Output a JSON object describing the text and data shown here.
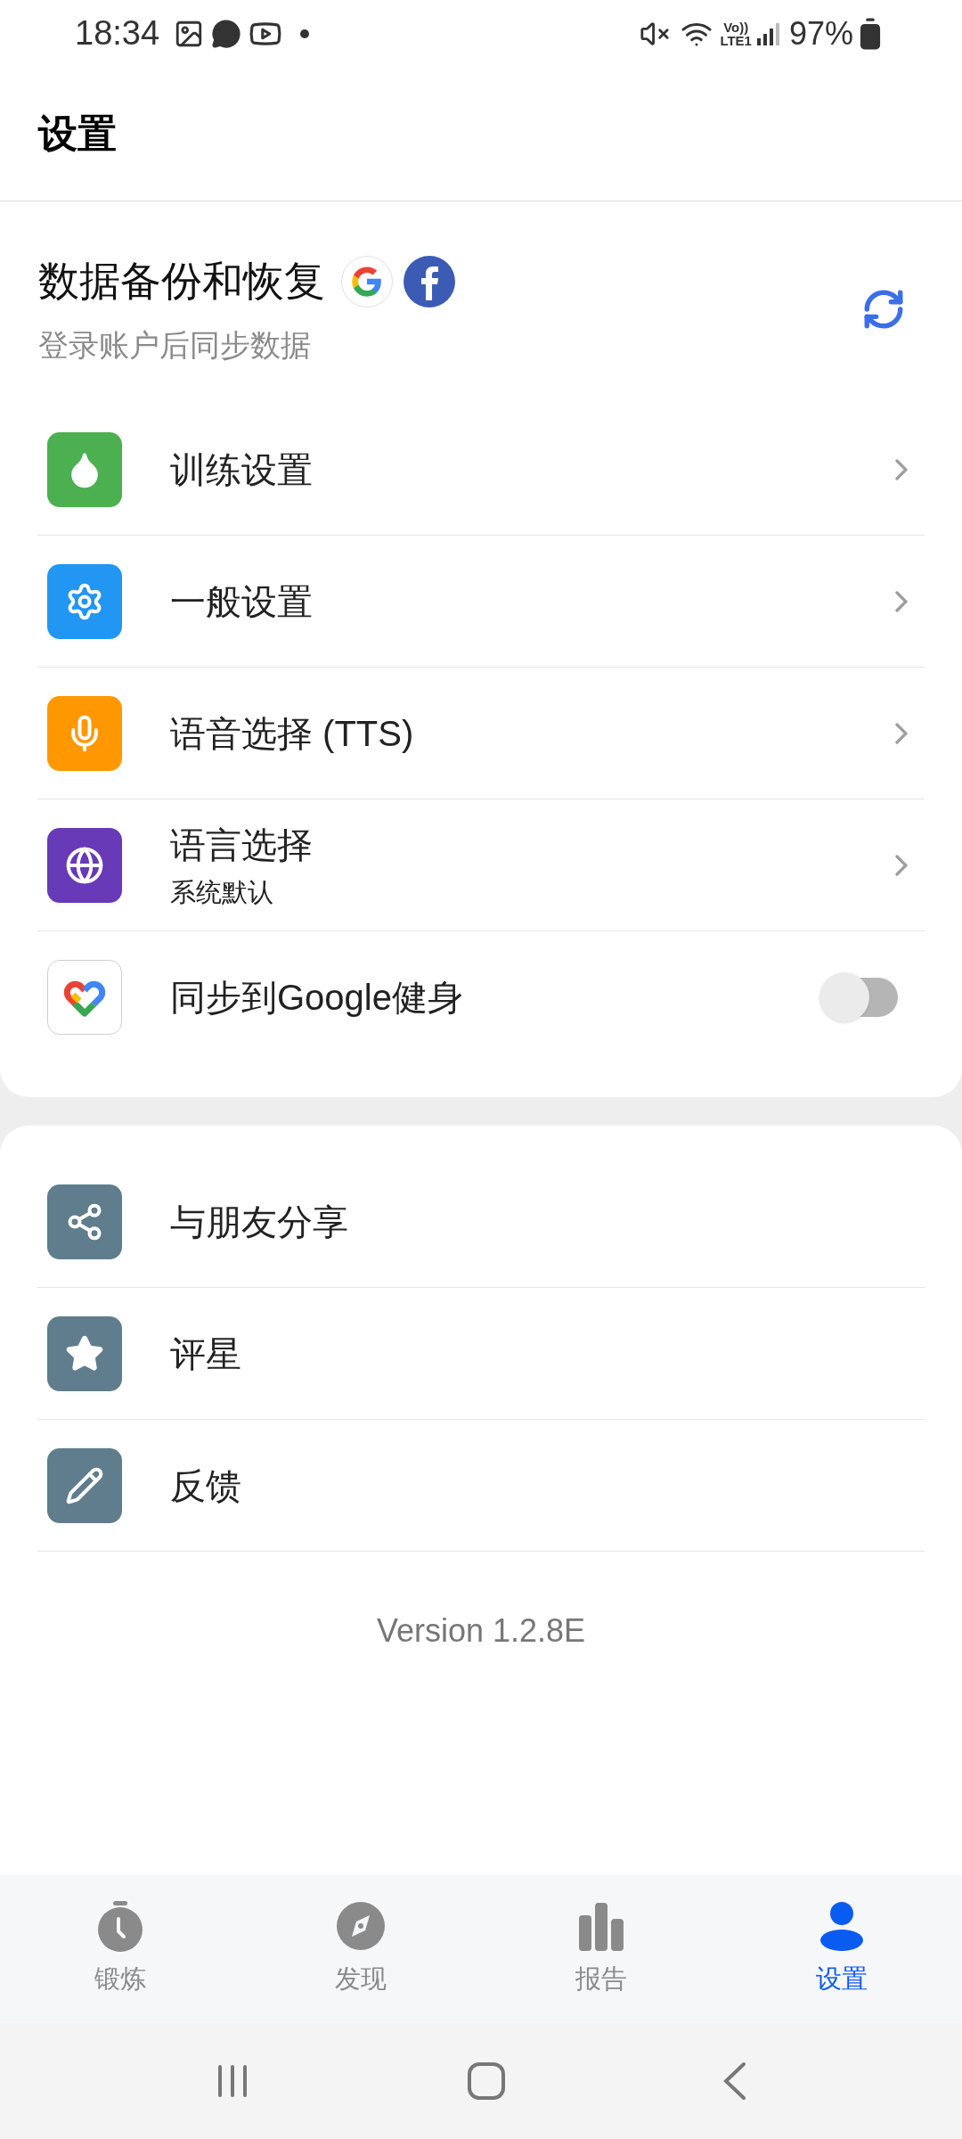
{
  "status_bar": {
    "time": "18:34",
    "network_top": "Vo))",
    "network_bottom": "LTE1",
    "battery": "97%"
  },
  "header": {
    "title": "设置"
  },
  "backup": {
    "title": "数据备份和恢复",
    "subtitle": "登录账户后同步数据"
  },
  "settings_group": [
    {
      "kind": "nav",
      "label": "训练设置",
      "color": "#4caf50"
    },
    {
      "kind": "nav",
      "label": "一般设置",
      "color": "#2196f3"
    },
    {
      "kind": "nav",
      "label": "语音选择 (TTS)",
      "color": "#ff9800"
    },
    {
      "kind": "nav",
      "label": "语言选择",
      "subtitle": "系统默认",
      "color": "#673ab7"
    },
    {
      "kind": "toggle",
      "label": "同步到Google健身",
      "color": "#ffffff",
      "on": false
    }
  ],
  "more_group": [
    {
      "label": "与朋友分享",
      "color": "#5f7d8c"
    },
    {
      "label": "评星",
      "color": "#5f7d8c"
    },
    {
      "label": "反馈",
      "color": "#5f7d8c"
    }
  ],
  "version": "Version 1.2.8E",
  "tabs": [
    {
      "label": "锻炼",
      "selected": false
    },
    {
      "label": "发现",
      "selected": false
    },
    {
      "label": "报告",
      "selected": false
    },
    {
      "label": "设置",
      "selected": true
    }
  ]
}
